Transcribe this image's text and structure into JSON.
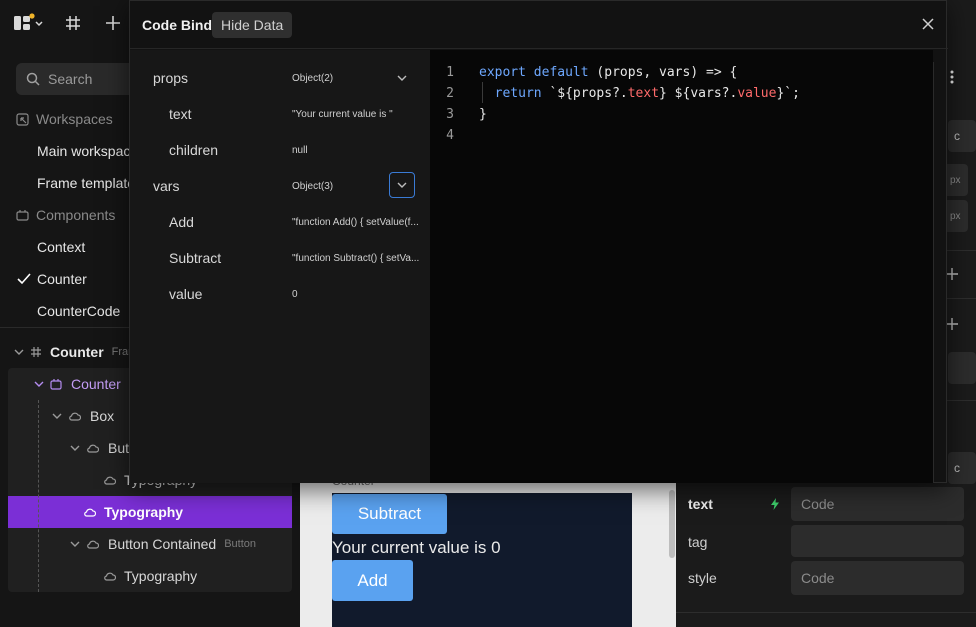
{
  "search": {
    "placeholder": "Search"
  },
  "sidebar": {
    "items": [
      {
        "label": "Workspaces",
        "icon": "workspaces-icon",
        "section": true
      },
      {
        "label": "Main workspace"
      },
      {
        "label": "Frame templates"
      },
      {
        "label": "Components",
        "icon": "components-icon",
        "section": true
      },
      {
        "label": "Context"
      },
      {
        "label": "Counter",
        "checked": true
      },
      {
        "label": "CounterCode"
      }
    ]
  },
  "tree": {
    "root": {
      "label": "Counter",
      "sub": "Frame"
    },
    "nodes": [
      {
        "label": "Counter"
      },
      {
        "label": "Box"
      },
      {
        "label": "Button Contained"
      },
      {
        "label": "Typography"
      },
      {
        "label": "Typography"
      },
      {
        "label": "Button Contained",
        "sub": "Button"
      },
      {
        "label": "Typography"
      }
    ]
  },
  "canvas": {
    "frame_label": "Counter",
    "subtract_label": "Subtract",
    "value_text": "Your current value is 0",
    "add_label": "Add"
  },
  "props_panel": {
    "rows": [
      {
        "label": "text",
        "value": "Code"
      },
      {
        "label": "tag",
        "value": ""
      },
      {
        "label": "style",
        "value": "Code"
      }
    ],
    "unit_1": "px",
    "unit_2": "px"
  },
  "modal": {
    "title": "Code Bind",
    "hide_label": "Hide Data",
    "data": [
      {
        "key": "props",
        "value": "Object(2)"
      },
      {
        "key": "text",
        "value": "\"Your current value is \""
      },
      {
        "key": "children",
        "value": "null"
      },
      {
        "key": "vars",
        "value": "Object(3)"
      },
      {
        "key": "Add",
        "value": "\"function Add() { setValue(f..."
      },
      {
        "key": "Subtract",
        "value": "\"function Subtract() { setVa..."
      },
      {
        "key": "value",
        "value": "0"
      }
    ],
    "code": {
      "line_numbers": [
        "1",
        "2",
        "3",
        "4"
      ]
    }
  },
  "colors": {
    "accent": "#7b2fd6",
    "button": "#5aa2f0",
    "keyword": "#6ea8ff",
    "property": "#ff6b6b"
  }
}
